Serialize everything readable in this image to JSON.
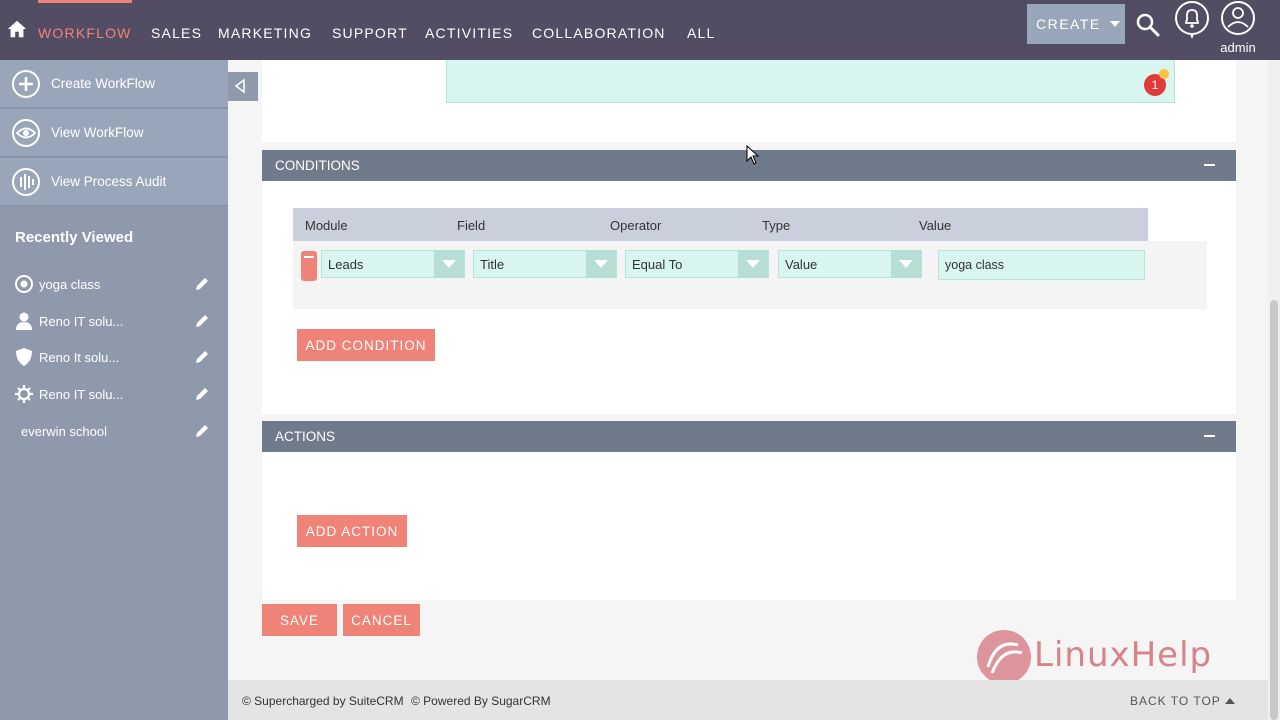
{
  "nav": {
    "items": [
      "WORKFLOW",
      "SALES",
      "MARKETING",
      "SUPPORT",
      "ACTIVITIES",
      "COLLABORATION",
      "ALL"
    ],
    "create_label": "CREATE",
    "user_label": "admin",
    "accent": "#f08377",
    "bar_color": "#534d64"
  },
  "sidebar": {
    "actions": [
      {
        "label": "Create WorkFlow",
        "icon": "plus-circle-icon"
      },
      {
        "label": "View WorkFlow",
        "icon": "eye-icon"
      },
      {
        "label": "View Process Audit",
        "icon": "audit-icon"
      }
    ],
    "recent_title": "Recently Viewed",
    "recent": [
      {
        "label": "yoga class",
        "icon": "target-icon"
      },
      {
        "label": "Reno IT solu...",
        "icon": "person-icon"
      },
      {
        "label": "Reno It solu...",
        "icon": "shield-icon"
      },
      {
        "label": "Reno IT solu...",
        "icon": "gear-icon"
      },
      {
        "label": "everwin school",
        "icon": ""
      }
    ]
  },
  "top_panel": {
    "badge_count": "1"
  },
  "conditions": {
    "title": "CONDITIONS",
    "headers": [
      "Module",
      "Field",
      "Operator",
      "Type",
      "Value"
    ],
    "row": {
      "module": "Leads",
      "field": "Title",
      "operator": "Equal To",
      "type": "Value",
      "value": "yoga class"
    },
    "add_label": "ADD CONDITION"
  },
  "actions": {
    "title": "ACTIONS",
    "add_label": "ADD ACTION"
  },
  "buttons": {
    "save": "SAVE",
    "cancel": "CANCEL"
  },
  "footer": {
    "supercharged": "© Supercharged by SuiteCRM",
    "powered": "© Powered By SugarCRM",
    "back_to_top": "BACK TO TOP"
  },
  "watermark": {
    "text": "LinuxHelp"
  }
}
